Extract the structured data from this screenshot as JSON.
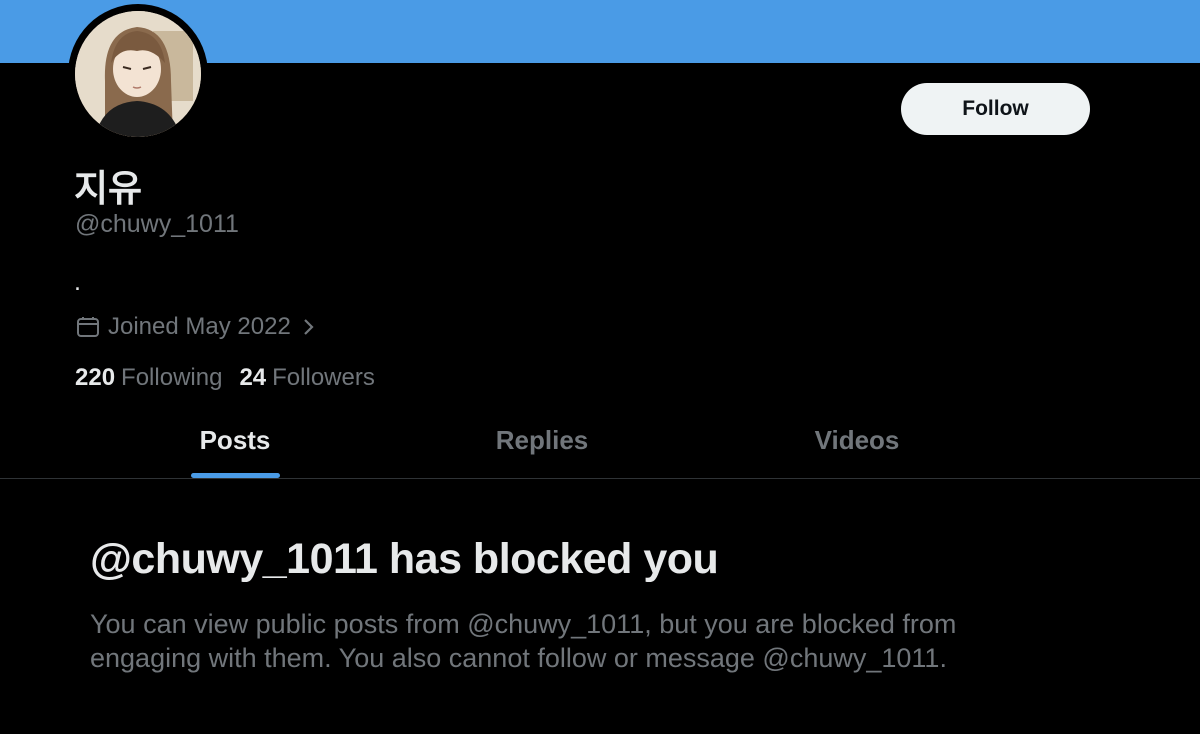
{
  "colors": {
    "banner": "#4a9be6",
    "accent": "#4a9be6",
    "background": "#000000",
    "muted": "#71767b",
    "text": "#e7e9ea"
  },
  "header": {
    "follow_label": "Follow"
  },
  "profile": {
    "display_name": "지유",
    "handle": "@chuwy_1011",
    "bio": ".",
    "joined": "Joined May 2022",
    "following_count": "220",
    "following_label": "Following",
    "followers_count": "24",
    "followers_label": "Followers"
  },
  "icons": {
    "calendar": "calendar-icon",
    "chevron": "chevron-right-icon"
  },
  "tabs": [
    {
      "label": "Posts",
      "active": true
    },
    {
      "label": "Replies",
      "active": false
    },
    {
      "label": "Videos",
      "active": false
    }
  ],
  "blocked": {
    "title": "@chuwy_1011 has blocked you",
    "message": "You can view public posts from @chuwy_1011, but you are blocked from engaging with them. You also cannot follow or message @chuwy_1011."
  }
}
